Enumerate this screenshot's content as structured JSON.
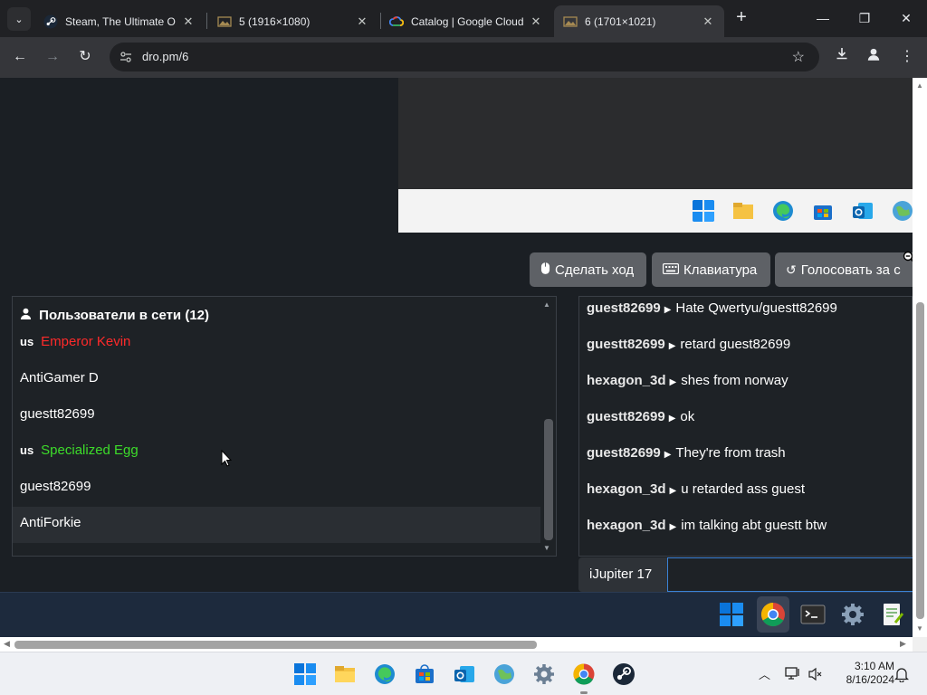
{
  "browser": {
    "tabs": [
      {
        "title": "Steam, The Ultimate O",
        "icon": "steam-icon"
      },
      {
        "title": "5 (1916×1080)",
        "icon": "image-icon"
      },
      {
        "title": "Catalog | Google Cloud",
        "icon": "google-cloud-icon"
      },
      {
        "title": "6 (1701×1021)",
        "icon": "image-icon",
        "active": true
      }
    ],
    "url": "dro.pm/6"
  },
  "page": {
    "buttons": {
      "move": "Сделать ход",
      "keyboard": "Клавиатура",
      "vote": "Голосовать за с"
    },
    "users": {
      "title": "Пользователи в сети (12)",
      "list": [
        {
          "flag": "us",
          "name": "Emperor Kevin",
          "color": "#ff2a2a"
        },
        {
          "flag": "",
          "name": "AntiGamer D",
          "color": "#ffffff"
        },
        {
          "flag": "",
          "name": "guestt82699",
          "color": "#ffffff"
        },
        {
          "flag": "us",
          "name": "Specialized Egg",
          "color": "#3ddc2a"
        },
        {
          "flag": "",
          "name": "guest82699",
          "color": "#ffffff"
        },
        {
          "flag": "",
          "name": "AntiForkie",
          "color": "#ffffff"
        }
      ]
    },
    "chat": {
      "messages": [
        {
          "user": "guest82699",
          "text": "Hate Qwertyu/guestt82699"
        },
        {
          "user": "guestt82699",
          "text": "retard guest82699"
        },
        {
          "user": "hexagon_3d",
          "text": "shes from norway"
        },
        {
          "user": "guestt82699",
          "text": "ok"
        },
        {
          "user": "guest82699",
          "text": "They're from trash"
        },
        {
          "user": "hexagon_3d",
          "text": "u retarded ass guest"
        },
        {
          "user": "hexagon_3d",
          "text": "im talking abt guestt btw"
        }
      ],
      "nickname": "iJupiter 17",
      "input_value": ""
    }
  },
  "taskbar": {
    "time": "3:10 AM",
    "date": "8/16/2024"
  }
}
